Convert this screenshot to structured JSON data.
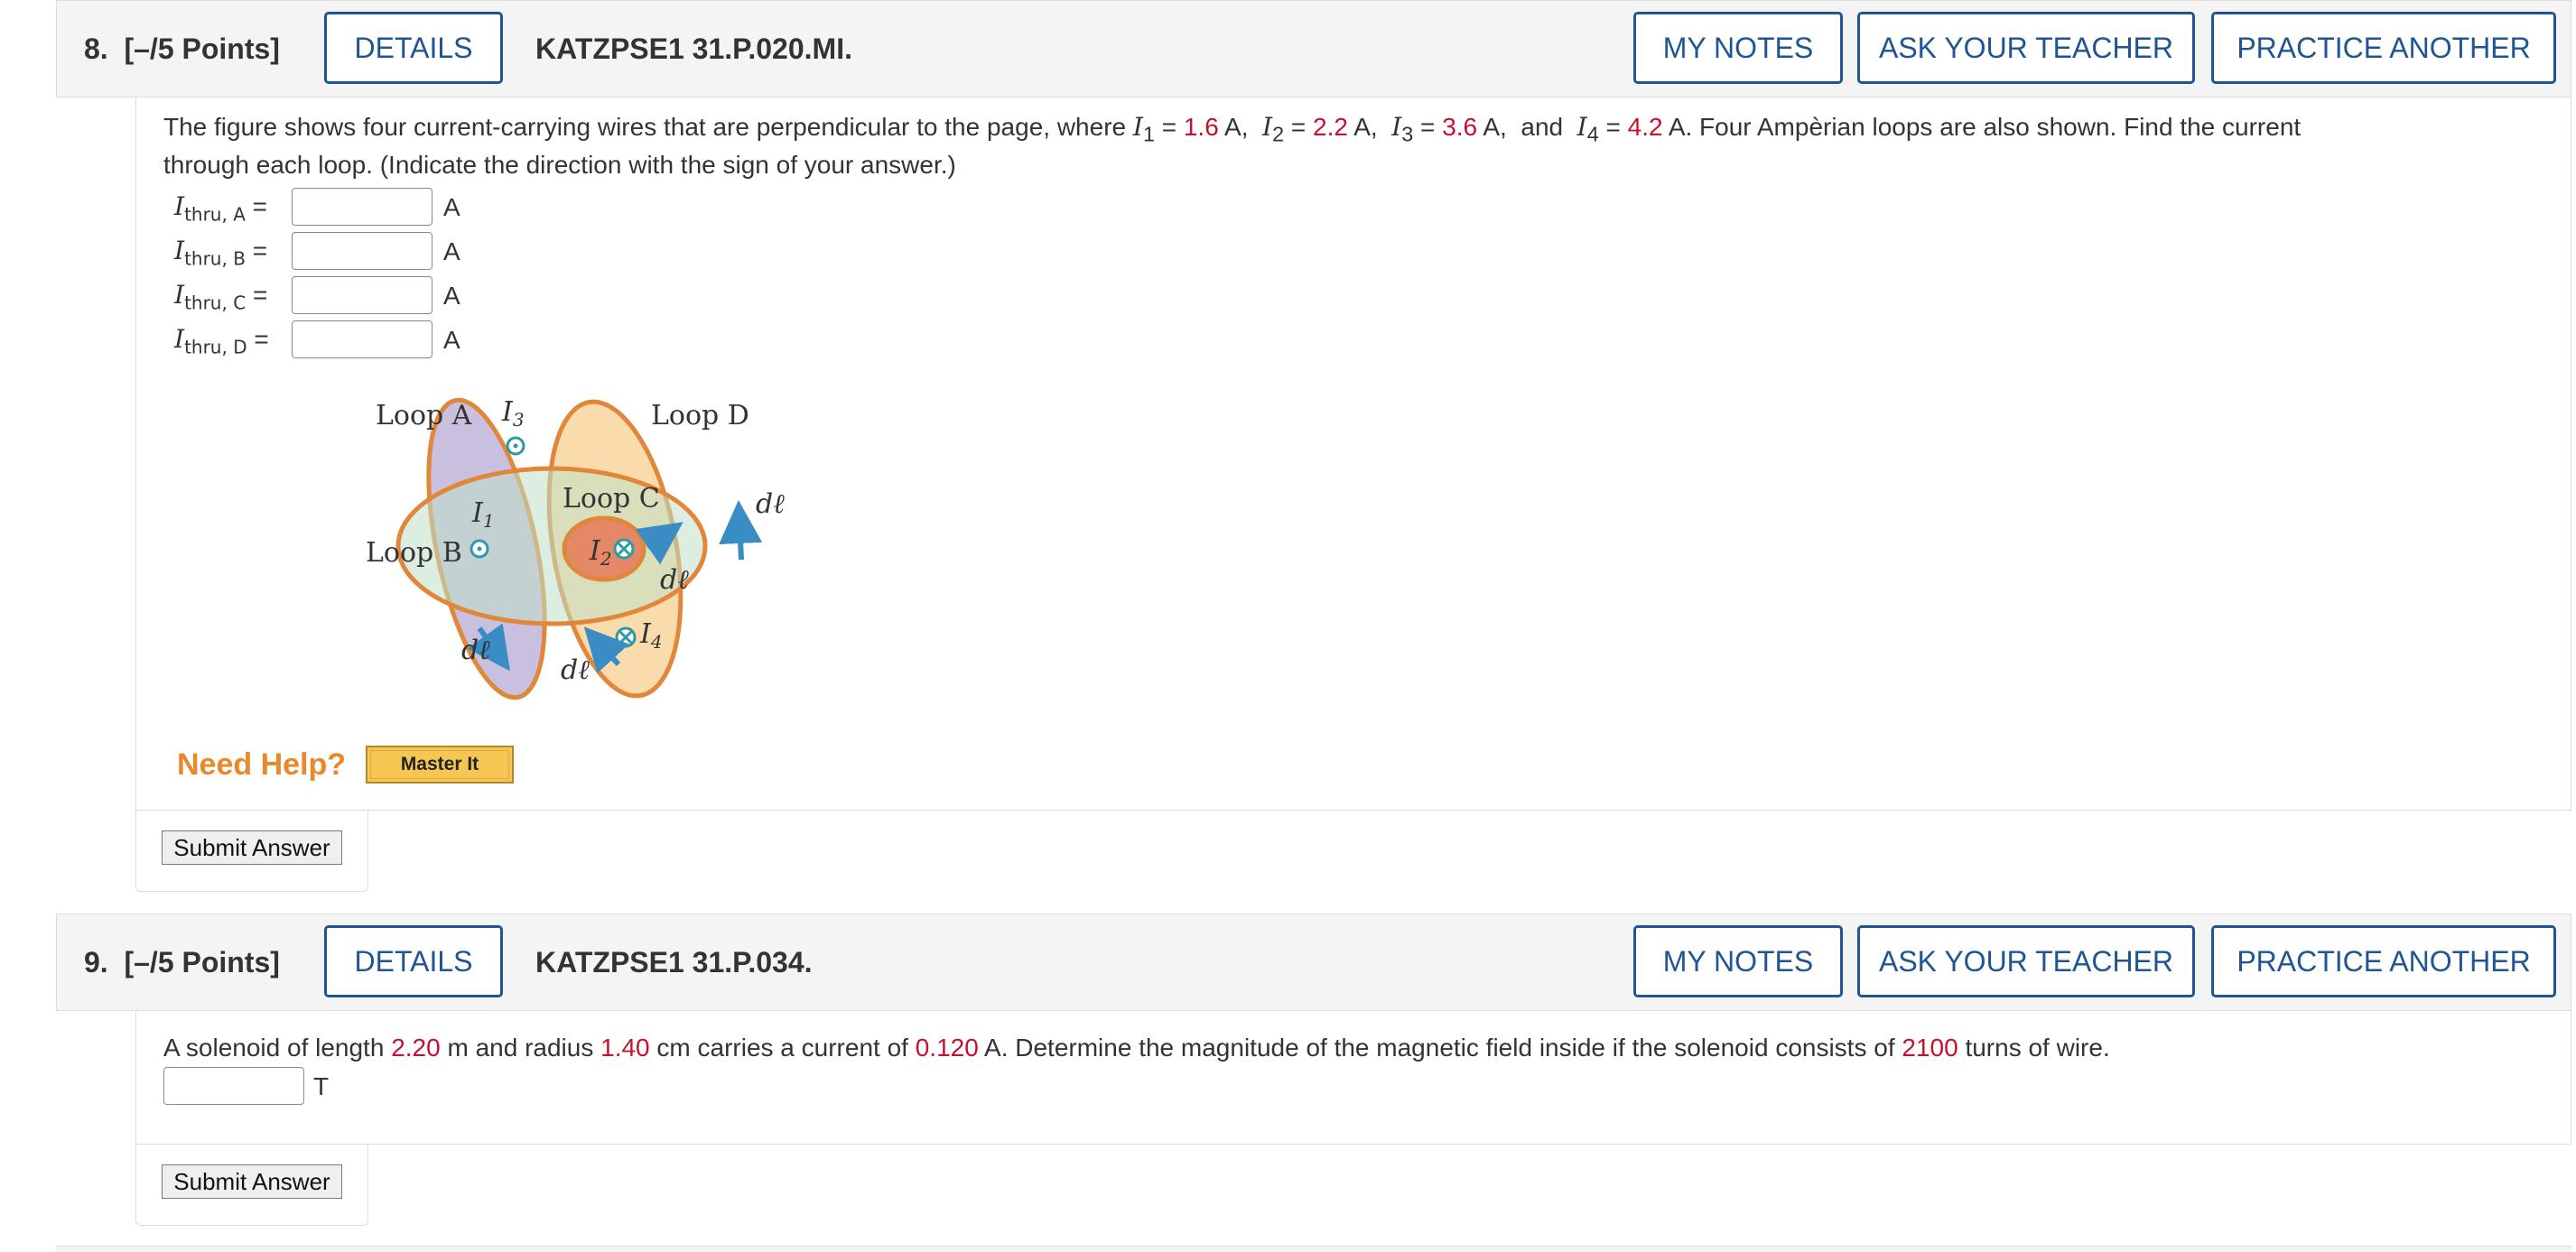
{
  "questions": [
    {
      "number": "8.",
      "points": "[–/5 Points]",
      "details_label": "DETAILS",
      "code": "KATZPSE1 31.P.020.MI.",
      "my_notes_label": "MY NOTES",
      "ask_teacher_label": "ASK YOUR TEACHER",
      "practice_label": "PRACTICE ANOTHER",
      "problem": {
        "t1": "The figure shows four current-carrying wires that are perpendicular to the page, where ",
        "i1_val": "1.6",
        "i2_val": "2.2",
        "i3_val": "3.6",
        "i4_val": "4.2",
        "amp": "A",
        "and": "and",
        "t2": " Four Ampèrian loops are also shown. Find the current",
        "t3": "through each loop. (Indicate the direction with the sign of your answer.)"
      },
      "answers": [
        {
          "symbol": "I",
          "sub": "thru, A",
          "eq": "=",
          "value": "",
          "unit": "A"
        },
        {
          "symbol": "I",
          "sub": "thru, B",
          "eq": "=",
          "value": "",
          "unit": "A"
        },
        {
          "symbol": "I",
          "sub": "thru, C",
          "eq": "=",
          "value": "",
          "unit": "A"
        },
        {
          "symbol": "I",
          "sub": "thru, D",
          "eq": "=",
          "value": "",
          "unit": "A"
        }
      ],
      "figure": {
        "loop_a": "Loop A",
        "loop_b": "Loop B",
        "loop_c": "Loop C",
        "loop_d": "Loop D",
        "i1": "I",
        "i1_sub": "1",
        "i2": "I",
        "i2_sub": "2",
        "i3": "I",
        "i3_sub": "3",
        "i4": "I",
        "i4_sub": "4",
        "dl": "dℓ"
      },
      "need_help": "Need Help?",
      "master_it": "Master It",
      "submit_label": "Submit Answer"
    },
    {
      "number": "9.",
      "points": "[–/5 Points]",
      "details_label": "DETAILS",
      "code": "KATZPSE1 31.P.034.",
      "my_notes_label": "MY NOTES",
      "ask_teacher_label": "ASK YOUR TEACHER",
      "practice_label": "PRACTICE ANOTHER",
      "problem": {
        "t1": "A solenoid of length ",
        "length": "2.20",
        "t2": " m and radius ",
        "radius": "1.40",
        "t3": " cm carries a current of ",
        "current": "0.120",
        "t4": " A. Determine the magnitude of the magnetic field inside if the solenoid consists of ",
        "turns": "2100",
        "t5": " turns of wire."
      },
      "answer": {
        "value": "",
        "unit": "T"
      },
      "submit_label": "Submit Answer"
    }
  ],
  "colors": {
    "accent": "#1f5593",
    "given_value": "#c8102e",
    "need_help": "#e8892b"
  }
}
